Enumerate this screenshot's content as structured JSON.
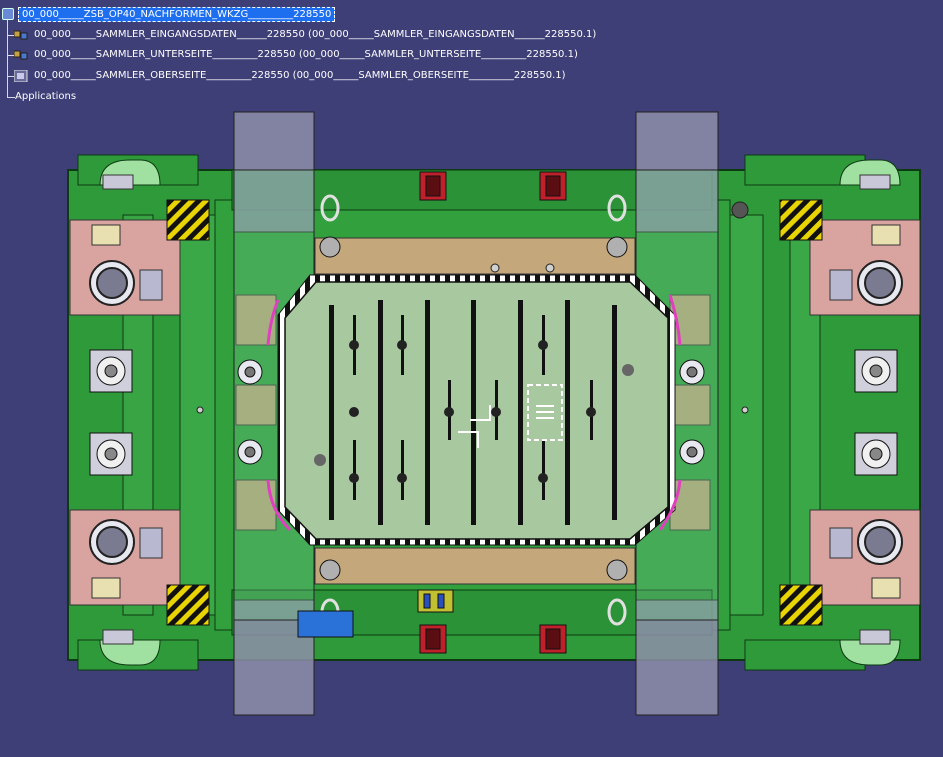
{
  "tree": {
    "root": {
      "label": "00_000_____ZSB_OP40_NACHFORMEN_WKZG_________228550"
    },
    "children": [
      {
        "label": "00_000_____SAMMLER_EINGANGSDATEN______228550 (00_000_____SAMMLER_EINGANGSDATEN______228550.1)",
        "icon": "product-icon"
      },
      {
        "label": "00_000_____SAMMLER_UNTERSEITE_________228550 (00_000_____SAMMLER_UNTERSEITE_________228550.1)",
        "icon": "product-icon"
      },
      {
        "label": "00_000_____SAMMLER_OBERSEITE_________228550 (00_000_____SAMMLER_OBERSEITE_________228550.1)",
        "icon": "product-icon"
      }
    ],
    "applications_label": "Applications"
  },
  "colors": {
    "background": "#3f3f78",
    "die_green": "#2f9a3a",
    "die_green_dark": "#1f6e28",
    "plate_light": "#a8c8a0",
    "pink_block": "#d9a3a0",
    "tan_block": "#c4a77a",
    "hazard_yellow": "#e8d400",
    "rail_gray": "#8e8eaa",
    "selection_blue": "#1e6ef0"
  }
}
